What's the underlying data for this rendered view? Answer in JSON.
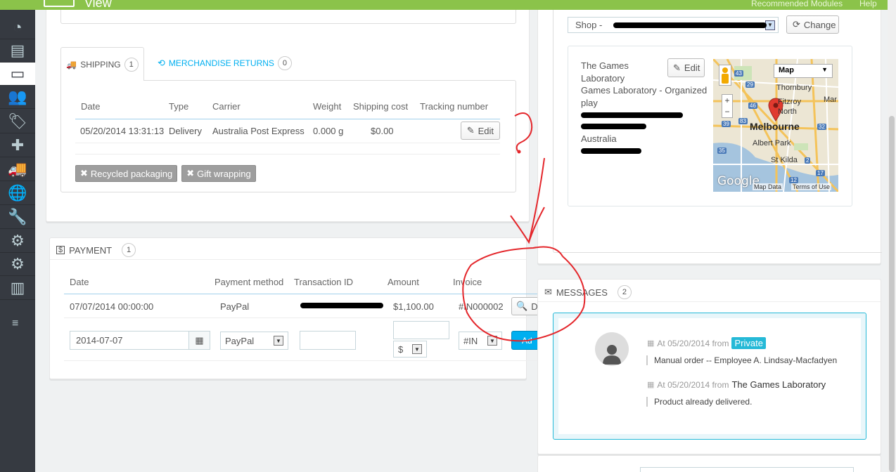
{
  "topbar": {
    "title": "View",
    "recommended": "Recommended Modules",
    "help": "Help",
    "color": "#8bc34a"
  },
  "sidebar": {
    "items": [
      {
        "icon": "dashboard-icon",
        "glyph": "◔"
      },
      {
        "icon": "catalog-icon",
        "glyph": "▤"
      },
      {
        "icon": "orders-icon",
        "glyph": "▭"
      },
      {
        "icon": "customers-icon",
        "glyph": "👥"
      },
      {
        "icon": "price-rules-icon",
        "glyph": "🏷"
      },
      {
        "icon": "modules-icon",
        "glyph": "✚"
      },
      {
        "icon": "shipping-icon",
        "glyph": "🚚"
      },
      {
        "icon": "localization-icon",
        "glyph": "🌐"
      },
      {
        "icon": "preferences-icon",
        "glyph": "🔧"
      },
      {
        "icon": "advanced-icon",
        "glyph": "⚙"
      },
      {
        "icon": "administration-icon",
        "glyph": "⚙"
      },
      {
        "icon": "stats-icon",
        "glyph": "▥"
      }
    ],
    "collapse_glyph": "≡"
  },
  "shipping": {
    "tab_label": "SHIPPING",
    "tab_count": "1",
    "returns_label": "MERCHANDISE RETURNS",
    "returns_count": "0",
    "columns": [
      "Date",
      "Type",
      "Carrier",
      "Weight",
      "Shipping cost",
      "Tracking number"
    ],
    "row": {
      "date": "05/20/2014 13:31:13",
      "type": "Delivery",
      "carrier": "Australia Post Express",
      "weight": "0.000 g",
      "cost": "$0.00",
      "edit": "Edit"
    },
    "recycled": "Recycled packaging",
    "gift": "Gift wrapping"
  },
  "payment": {
    "title": "PAYMENT",
    "count": "1",
    "columns": [
      "Date",
      "Payment method",
      "Transaction ID",
      "Amount",
      "Invoice"
    ],
    "row": {
      "date": "07/07/2014 00:00:00",
      "method": "PayPal",
      "amount": "$1,100.00",
      "invoice": "#IN000002",
      "details": "De"
    },
    "form": {
      "date": "2014-07-07",
      "method": "PayPal",
      "currency": "$",
      "invoice": "#IN",
      "add": "Ad"
    }
  },
  "address": {
    "shop_select": "Shop - ",
    "change": "Change",
    "edit": "Edit",
    "line1": "The Games",
    "line2": "Laboratory",
    "line3": "Games Laboratory - Organized",
    "line4": "play",
    "country": "Australia",
    "map": {
      "type_label": "Map",
      "city": "Melbourne",
      "places": [
        "Thornbury",
        "Fitzroy",
        "North",
        "Albert Park",
        "St Kilda",
        "Mar"
      ],
      "footer_logo": "Google",
      "map_data": "Map Data",
      "terms": "Terms of Use",
      "road_numbers": [
        "43",
        "29",
        "46",
        "38",
        "39",
        "83",
        "32",
        "35",
        "2",
        "17",
        "12"
      ]
    }
  },
  "messages": {
    "title": "MESSAGES",
    "count": "2",
    "items": [
      {
        "date": "At 05/20/2014 from",
        "author": "Private",
        "text": "Manual order -- Employee A. Lindsay-Macfadyen"
      },
      {
        "date": "At 05/20/2014 from",
        "author": "The Games Laboratory",
        "text": "Product already delivered."
      }
    ]
  }
}
